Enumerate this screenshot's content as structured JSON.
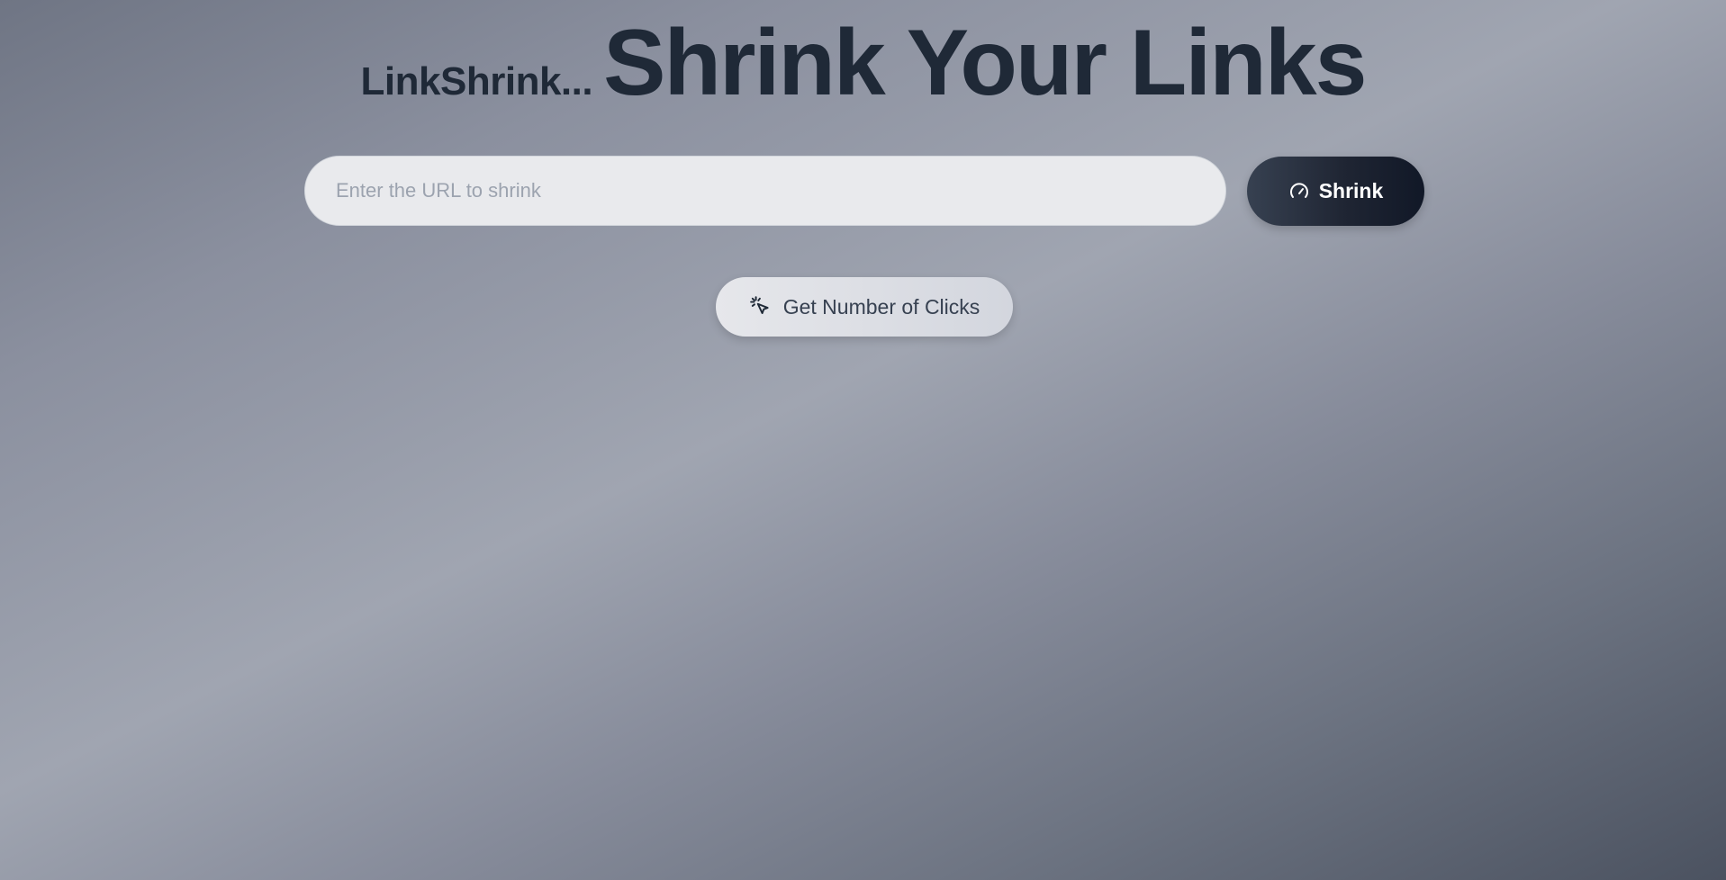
{
  "header": {
    "brand": "LinkShrink...",
    "headline": "Shrink Your Links"
  },
  "form": {
    "url_placeholder": "Enter the URL to shrink",
    "url_value": "",
    "shrink_label": "Shrink",
    "shrink_icon": "gauge-icon"
  },
  "actions": {
    "clicks_label": "Get Number of Clicks",
    "clicks_icon": "cursor-click-icon"
  },
  "colors": {
    "text_dark": "#1f2937",
    "primary_button": "#1f2533",
    "input_bg": "#e9eaed"
  }
}
